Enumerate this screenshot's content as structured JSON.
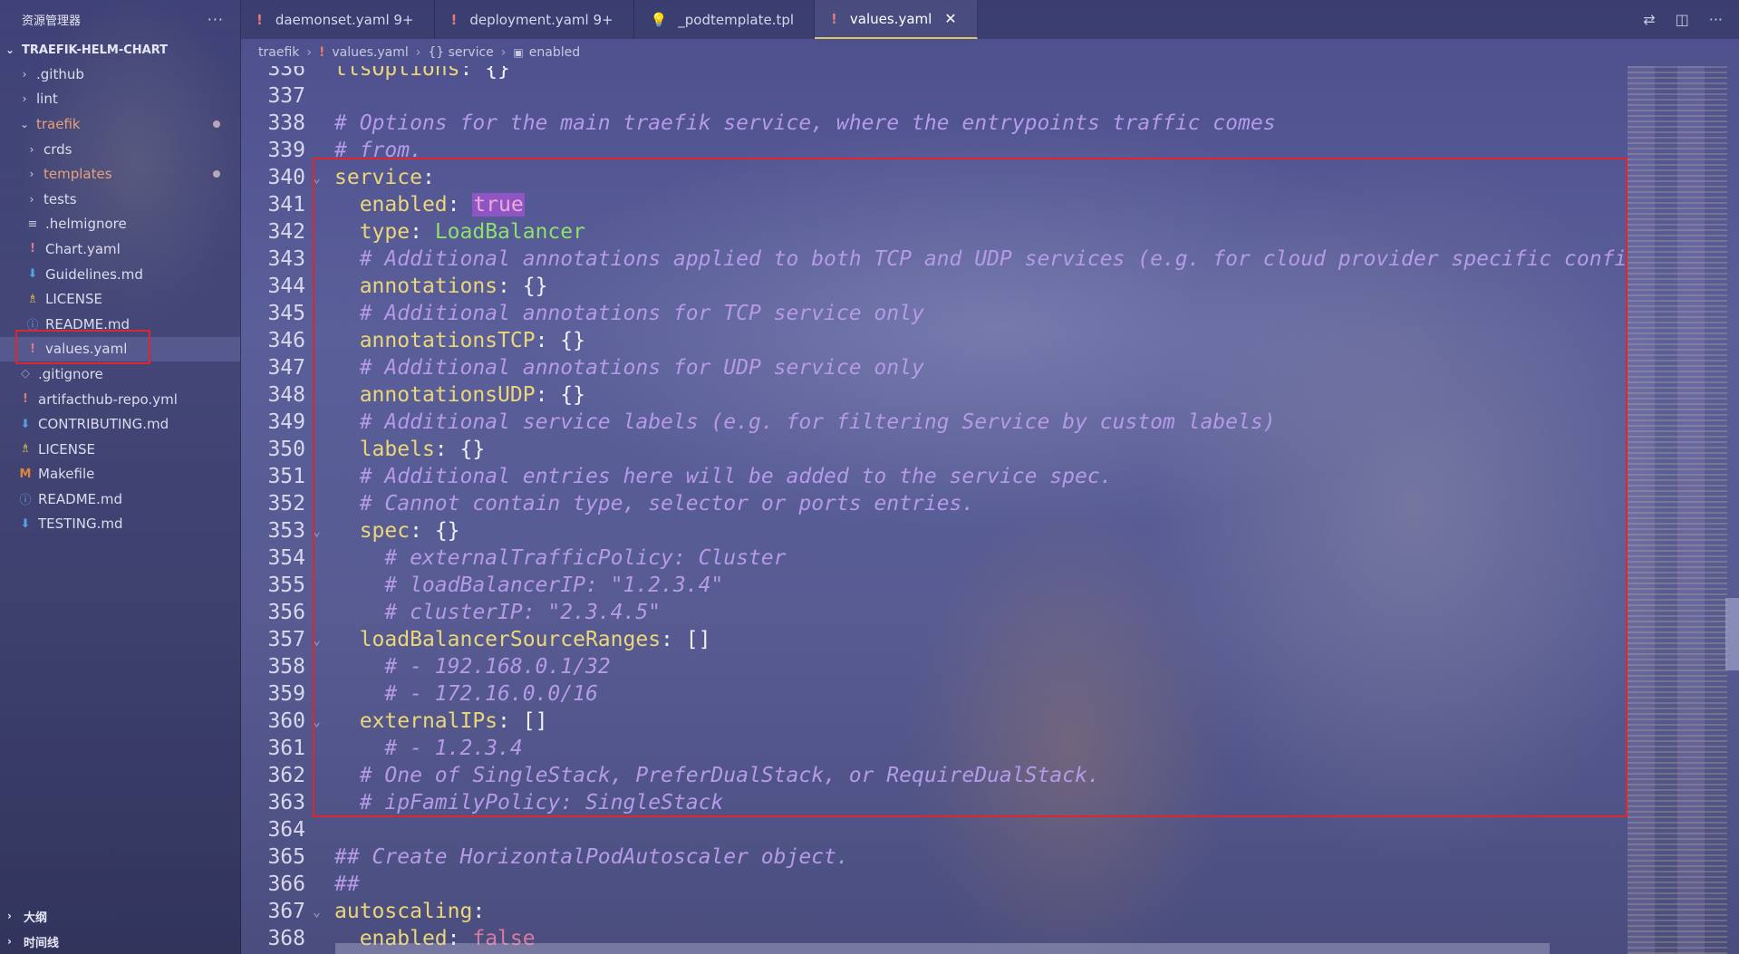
{
  "sidebar": {
    "title": "资源管理器",
    "more": "···",
    "root": "TRAEFIK-HELM-CHART",
    "items": [
      {
        "label": ".github",
        "chev": "›",
        "icon": "",
        "indent": 1
      },
      {
        "label": "lint",
        "chev": "›",
        "icon": "",
        "indent": 1
      },
      {
        "label": "traefik",
        "chev": "⌄",
        "icon": "",
        "indent": 1,
        "modified": true
      },
      {
        "label": "crds",
        "chev": "›",
        "icon": "",
        "indent": 2
      },
      {
        "label": "templates",
        "chev": "›",
        "icon": "",
        "indent": 2,
        "modified": true
      },
      {
        "label": "tests",
        "chev": "›",
        "icon": "",
        "indent": 2
      },
      {
        "label": ".helmignore",
        "chev": "",
        "icon": "≡",
        "indent": 2
      },
      {
        "label": "Chart.yaml",
        "chev": "",
        "icon": "!",
        "indent": 2
      },
      {
        "label": "Guidelines.md",
        "chev": "",
        "icon": "⬇",
        "indent": 2
      },
      {
        "label": "LICENSE",
        "chev": "",
        "icon": "♗",
        "indent": 2
      },
      {
        "label": "README.md",
        "chev": "",
        "icon": "ⓘ",
        "indent": 2
      },
      {
        "label": "values.yaml",
        "chev": "",
        "icon": "!",
        "indent": 2,
        "selected": true
      },
      {
        "label": ".gitignore",
        "chev": "",
        "icon": "◇",
        "indent": 1
      },
      {
        "label": "artifacthub-repo.yml",
        "chev": "",
        "icon": "!",
        "indent": 1
      },
      {
        "label": "CONTRIBUTING.md",
        "chev": "",
        "icon": "⬇",
        "indent": 1
      },
      {
        "label": "LICENSE",
        "chev": "",
        "icon": "♗",
        "indent": 1
      },
      {
        "label": "Makefile",
        "chev": "",
        "icon": "M",
        "indent": 1
      },
      {
        "label": "README.md",
        "chev": "",
        "icon": "ⓘ",
        "indent": 1
      },
      {
        "label": "TESTING.md",
        "chev": "",
        "icon": "⬇",
        "indent": 1
      }
    ],
    "bottom": [
      {
        "label": "大纲"
      },
      {
        "label": "时间线"
      }
    ]
  },
  "tabs": [
    {
      "label": "daemonset.yaml 9+",
      "icon": "!",
      "active": false
    },
    {
      "label": "deployment.yaml 9+",
      "icon": "!",
      "active": false
    },
    {
      "label": "_podtemplate.tpl",
      "icon": "bulb",
      "active": false
    },
    {
      "label": "values.yaml",
      "icon": "!",
      "active": true,
      "close": "✕"
    }
  ],
  "breadcrumb": {
    "folder": "traefik",
    "file": "values.yaml",
    "section": "{} service",
    "leaf": "enabled"
  },
  "editor": {
    "lines": [
      {
        "n": "336",
        "text": "tlsOptions: {}"
      },
      {
        "n": "337",
        "text": ""
      },
      {
        "n": "338",
        "text": "# Options for the main traefik service, where the entrypoints traffic comes"
      },
      {
        "n": "339",
        "text": "# from."
      },
      {
        "n": "340",
        "text": "service:"
      },
      {
        "n": "341",
        "text": "  enabled: true"
      },
      {
        "n": "342",
        "text": "  type: LoadBalancer"
      },
      {
        "n": "343",
        "text": "  # Additional annotations applied to both TCP and UDP services (e.g. for cloud provider specific confi"
      },
      {
        "n": "344",
        "text": "  annotations: {}"
      },
      {
        "n": "345",
        "text": "  # Additional annotations for TCP service only"
      },
      {
        "n": "346",
        "text": "  annotationsTCP: {}"
      },
      {
        "n": "347",
        "text": "  # Additional annotations for UDP service only"
      },
      {
        "n": "348",
        "text": "  annotationsUDP: {}"
      },
      {
        "n": "349",
        "text": "  # Additional service labels (e.g. for filtering Service by custom labels)"
      },
      {
        "n": "350",
        "text": "  labels: {}"
      },
      {
        "n": "351",
        "text": "  # Additional entries here will be added to the service spec."
      },
      {
        "n": "352",
        "text": "  # Cannot contain type, selector or ports entries."
      },
      {
        "n": "353",
        "text": "  spec: {}"
      },
      {
        "n": "354",
        "text": "    # externalTrafficPolicy: Cluster"
      },
      {
        "n": "355",
        "text": "    # loadBalancerIP: \"1.2.3.4\""
      },
      {
        "n": "356",
        "text": "    # clusterIP: \"2.3.4.5\""
      },
      {
        "n": "357",
        "text": "  loadBalancerSourceRanges: []"
      },
      {
        "n": "358",
        "text": "    # - 192.168.0.1/32"
      },
      {
        "n": "359",
        "text": "    # - 172.16.0.0/16"
      },
      {
        "n": "360",
        "text": "  externalIPs: []"
      },
      {
        "n": "361",
        "text": "    # - 1.2.3.4"
      },
      {
        "n": "362",
        "text": "  # One of SingleStack, PreferDualStack, or RequireDualStack."
      },
      {
        "n": "363",
        "text": "  # ipFamilyPolicy: SingleStack"
      },
      {
        "n": "364",
        "text": ""
      },
      {
        "n": "365",
        "text": "## Create HorizontalPodAutoscaler object."
      },
      {
        "n": "366",
        "text": "##"
      },
      {
        "n": "367",
        "text": "autoscaling:"
      },
      {
        "n": "368",
        "text": "  enabled: false"
      }
    ]
  },
  "colors": {
    "highlight_box": "#e0262d",
    "active_tab_border": "#d6c867"
  }
}
